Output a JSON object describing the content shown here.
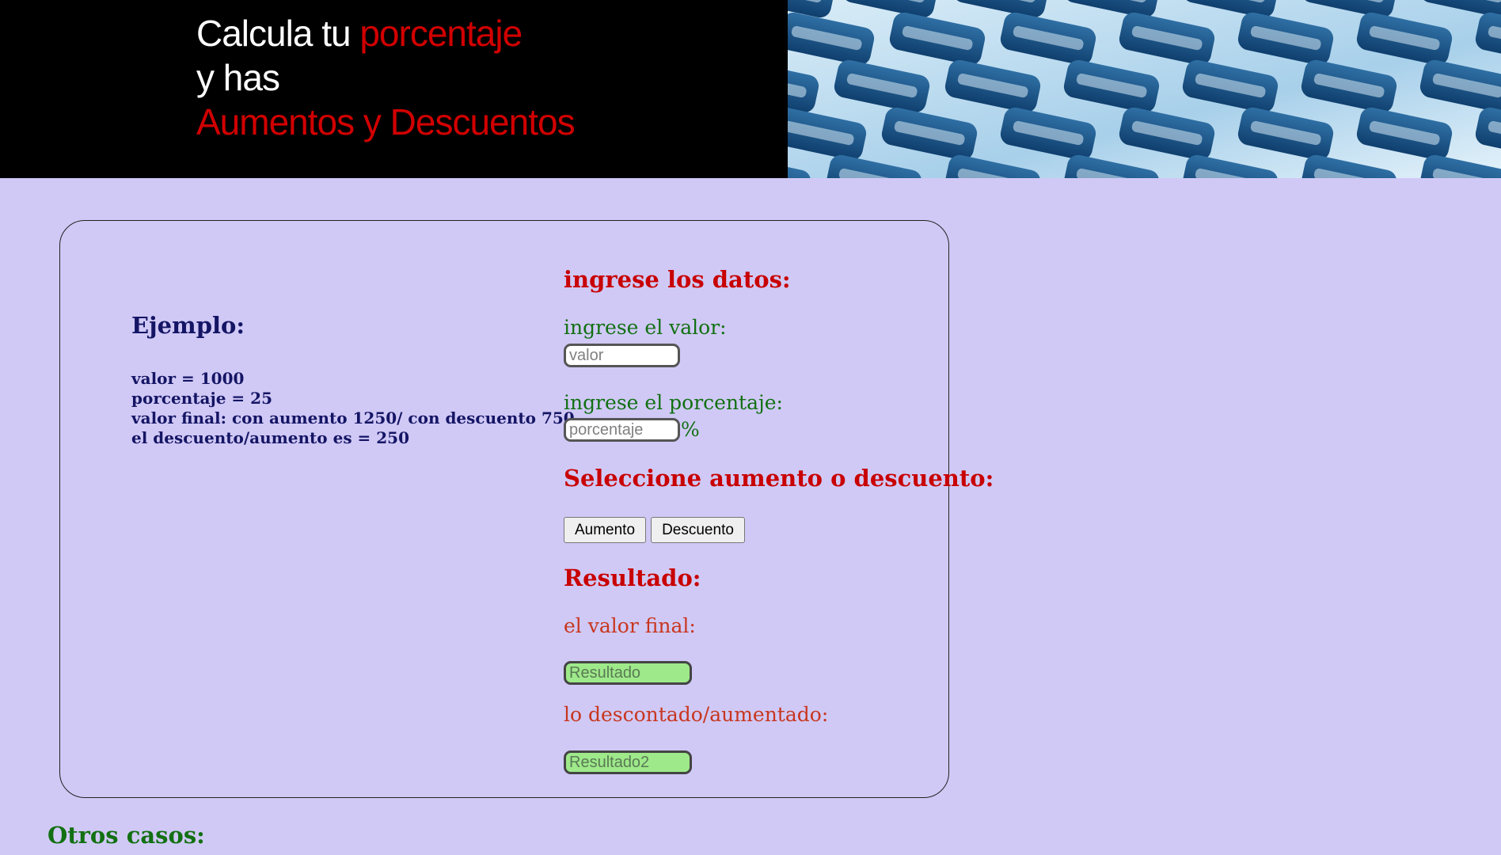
{
  "header": {
    "title_part1": "Calcula tu ",
    "title_part2": "porcentaje",
    "title_line2": "y has",
    "title_line3": "Aumentos y Descuentos",
    "hero_image": "calculator-keypad"
  },
  "example": {
    "title": "Ejemplo:",
    "lines": [
      "valor = 1000",
      "porcentaje = 25",
      "valor final: con aumento 1250/ con descuento 750",
      "el descuento/aumento es = 250"
    ]
  },
  "form": {
    "heading": "ingrese los datos:",
    "valor_label": "ingrese el valor:",
    "valor_placeholder": "valor",
    "porcentaje_label": "ingrese el porcentaje:",
    "porcentaje_placeholder": "porcentaje",
    "percent_sign": "%",
    "select_heading": "Seleccione aumento o descuento:",
    "aumento_button": "Aumento",
    "descuento_button": "Descuento",
    "resultado_heading": "Resultado:",
    "valor_final_label": "el valor final:",
    "resultado_placeholder": "Resultado",
    "descontado_label": "lo descontado/aumentado:",
    "resultado2_placeholder": "Resultado2"
  },
  "footer": {
    "otros_casos": "Otros casos:"
  },
  "colors": {
    "background": "#d0c9f6",
    "accent_red": "#c80000",
    "green": "#127012",
    "result_green": "#9ee98a"
  }
}
